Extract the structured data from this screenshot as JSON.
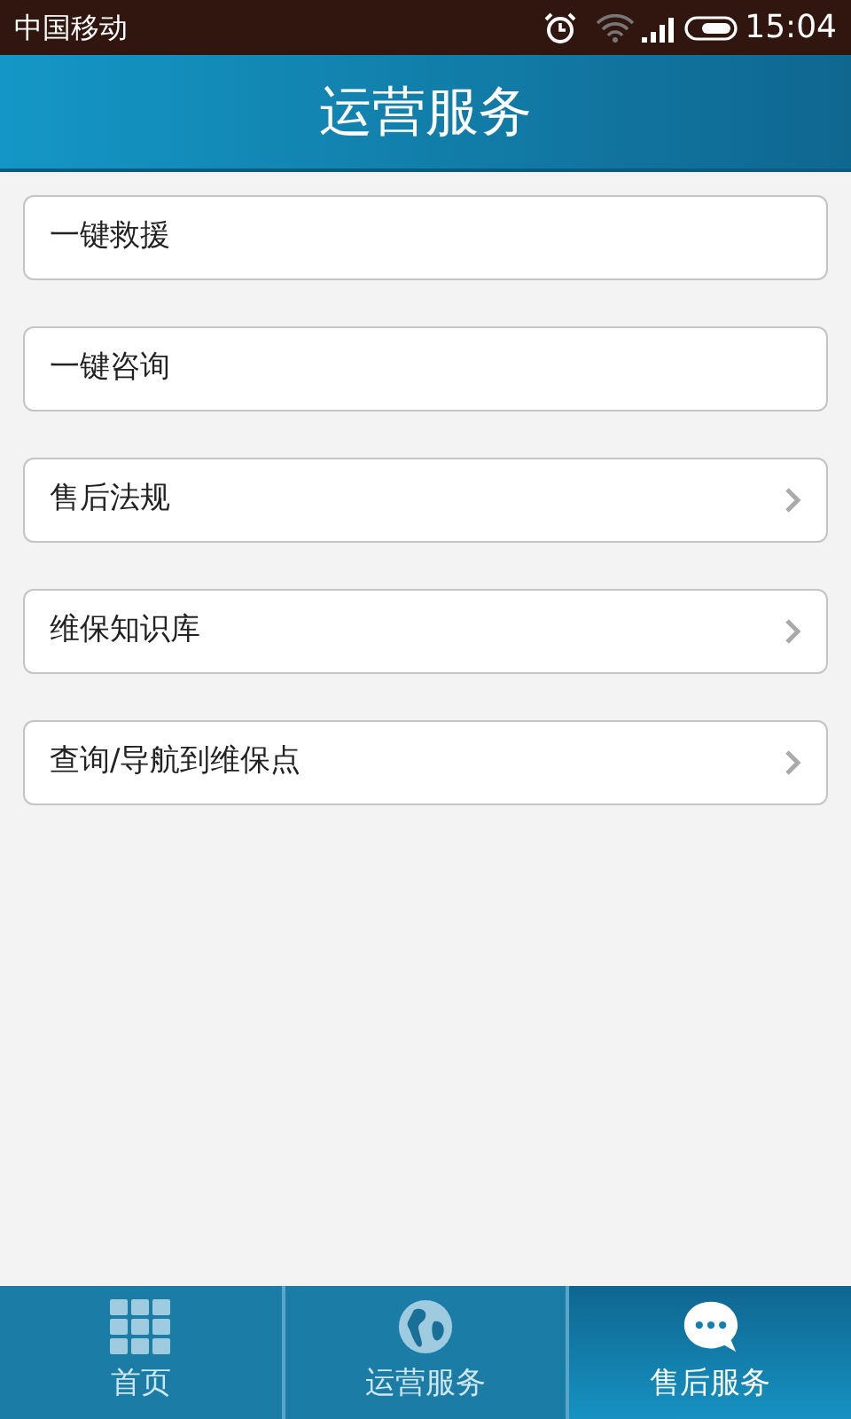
{
  "status_bar": {
    "carrier": "中国移动",
    "time": "15:04"
  },
  "header": {
    "title": "运营服务"
  },
  "menu": [
    {
      "label": "一键救援",
      "has_chevron": false
    },
    {
      "label": "一键咨询",
      "has_chevron": false
    },
    {
      "label": "售后法规",
      "has_chevron": true
    },
    {
      "label": "维保知识库",
      "has_chevron": true
    },
    {
      "label": "查询/导航到维保点",
      "has_chevron": true
    }
  ],
  "tabs": [
    {
      "label": "首页",
      "kind": "grid",
      "selected": false
    },
    {
      "label": "运营服务",
      "kind": "globe",
      "selected": false
    },
    {
      "label": "售后服务",
      "kind": "chat",
      "selected": true
    }
  ]
}
